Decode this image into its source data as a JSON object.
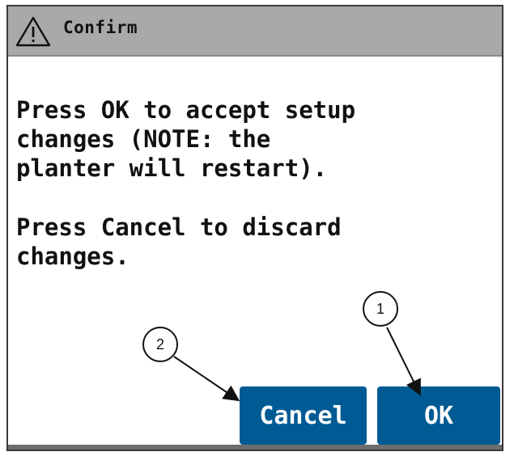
{
  "dialog": {
    "title": "Confirm",
    "title_icon": "warning-triangle-icon",
    "message_1": "Press OK to accept setup\nchanges (NOTE: the\nplanter will restart).",
    "message_2": "Press Cancel to discard\nchanges."
  },
  "buttons": {
    "cancel_label": "Cancel",
    "ok_label": "OK"
  },
  "callouts": {
    "ok_number": "1",
    "cancel_number": "2"
  },
  "colors": {
    "titlebar": "#a9a9a9",
    "button": "#005b94",
    "button_text": "#ffffff"
  }
}
